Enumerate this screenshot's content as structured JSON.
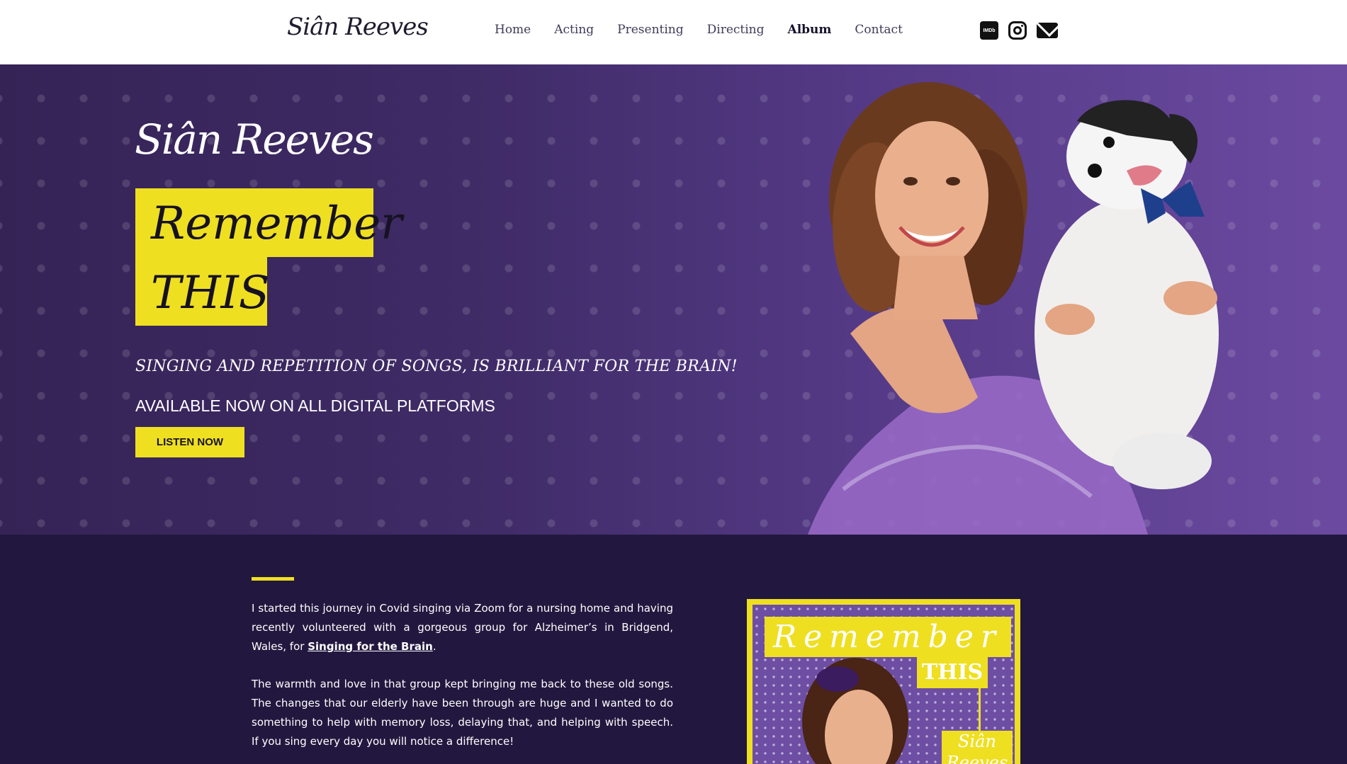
{
  "header": {
    "logo": "Siân Reeves",
    "nav": [
      {
        "label": "Home"
      },
      {
        "label": "Acting"
      },
      {
        "label": "Presenting"
      },
      {
        "label": "Directing"
      },
      {
        "label": "Album",
        "active": true
      },
      {
        "label": "Contact"
      }
    ],
    "social": {
      "imdb_label": "IMDb"
    },
    "icons": [
      "imdb-icon",
      "instagram-icon",
      "envelope-icon"
    ]
  },
  "hero": {
    "signature": "Siân Reeves",
    "title_line1": "Remember",
    "title_line2": "THIS",
    "tagline": "SINGING AND REPETITION OF SONGS, IS BRILLIANT FOR THE BRAIN!",
    "availability": "AVAILABLE NOW ON ALL DIGITAL PLATFORMS",
    "button_label": "LISTEN NOW"
  },
  "content": {
    "para1_before": "I started this journey in Covid singing via Zoom for a nursing home and having recently volunteered with a gorgeous group for Alzheimer’s in Bridgend, Wales, for ",
    "para1_link": "Singing for the Brain",
    "para1_after": ".",
    "para2": "The warmth and love in that group kept bringing me back to these old songs. The changes that our elderly have been through are huge and I wanted to do something to help with memory loss, delaying that, and helping with speech. If you sing every day you will notice a difference!"
  },
  "album_cover": {
    "title1": "Remember",
    "title2": "THIS",
    "name": "Siân Reeves"
  },
  "colors": {
    "accent": "#efdf21",
    "hero_purple": "#553a87",
    "dark_bg": "#22183f"
  }
}
